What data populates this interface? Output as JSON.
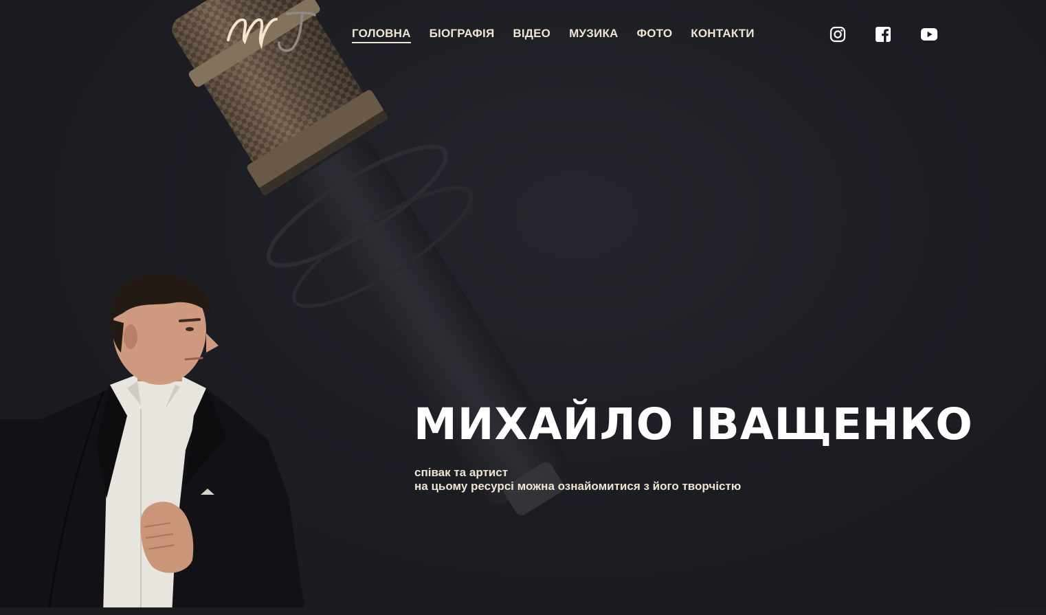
{
  "header": {
    "logo_text": "MI",
    "nav": [
      {
        "label": "ГОЛОВНА",
        "active": true
      },
      {
        "label": "БІОГРАФІЯ",
        "active": false
      },
      {
        "label": "ВІДЕО",
        "active": false
      },
      {
        "label": "МУЗИКА",
        "active": false
      },
      {
        "label": "ФОТО",
        "active": false
      },
      {
        "label": "КОНТАКТИ",
        "active": false
      }
    ],
    "social": [
      {
        "icon": "instagram-icon"
      },
      {
        "icon": "facebook-icon"
      },
      {
        "icon": "youtube-icon"
      }
    ]
  },
  "hero": {
    "title": "МИХАЙЛО ІВАЩЕНКО",
    "subtitle_line1": "співак та артист",
    "subtitle_line2": "на цьому ресурсі можна ознайомитися з його творчістю"
  },
  "colors": {
    "background": "#1d1d24",
    "accent_text": "#efe6d2",
    "title_text": "#ffffff"
  }
}
